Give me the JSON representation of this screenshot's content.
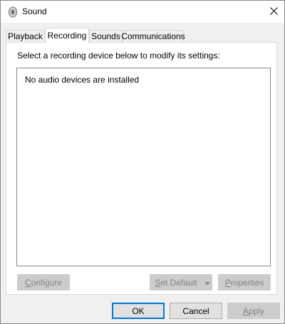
{
  "window": {
    "title": "Sound",
    "icon": "speaker-icon",
    "close_icon": "close-icon"
  },
  "tabs": [
    {
      "label": "Playback",
      "active": false
    },
    {
      "label": "Recording",
      "active": true
    },
    {
      "label": "Sounds",
      "active": false
    },
    {
      "label": "Communications",
      "active": false
    }
  ],
  "panel": {
    "instruction": "Select a recording device below to modify its settings:",
    "empty_message": "No audio devices are installed",
    "buttons": {
      "configure": {
        "accel": "C",
        "rest": "onfigure",
        "enabled": false
      },
      "set_default": {
        "accel": "S",
        "rest": "et Default",
        "enabled": false
      },
      "properties": {
        "accel": "P",
        "rest": "roperties",
        "enabled": false
      }
    }
  },
  "footer": {
    "ok": "OK",
    "cancel": "Cancel",
    "apply_accel": "A",
    "apply_rest": "pply"
  },
  "colors": {
    "accent": "#0078d7",
    "disabled_button": "#cccccc",
    "disabled_text": "#838383"
  }
}
